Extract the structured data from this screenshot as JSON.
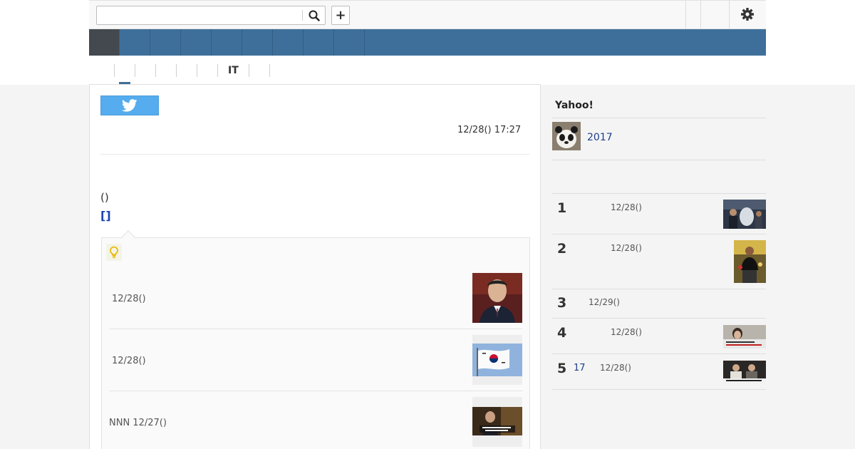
{
  "header": {
    "search_placeholder": "",
    "search_icon": "search-icon",
    "plus_label": "+",
    "settings_icon": "gear-icon"
  },
  "nav": {
    "tab_count": 9,
    "active_index": 0
  },
  "categories": [
    "",
    "",
    "",
    "",
    "",
    "IT",
    "",
    ""
  ],
  "article": {
    "tweet_icon": "twitter-bird-icon",
    "timestamp": "12/28() 17:27",
    "paren_text": "()",
    "bracket_link": "[]",
    "tip_icon": "lightbulb-icon",
    "related": [
      {
        "date": "12/28()",
        "thumb": "portrait-man"
      },
      {
        "date": "12/28()",
        "thumb": "korean-flag"
      },
      {
        "date": "NNN 12/27()",
        "thumb": "news-still"
      }
    ]
  },
  "sidebar": {
    "title": "Yahoo!",
    "promo_text": "2017",
    "promo_icon": "panda-thumbnail",
    "ranking": [
      {
        "rank": "1",
        "link": "",
        "date": "12/28()"
      },
      {
        "rank": "2",
        "link": "",
        "date": "12/28()"
      },
      {
        "rank": "3",
        "link": "",
        "date": "12/29()"
      },
      {
        "rank": "4",
        "link": "",
        "date": "12/28()"
      },
      {
        "rank": "5",
        "link": "17",
        "date": "12/28()"
      }
    ]
  },
  "colors": {
    "nav_blue": "#3e6f9a",
    "nav_active": "#44494f",
    "twitter_blue": "#55acee",
    "link_blue": "#1a41b8"
  }
}
